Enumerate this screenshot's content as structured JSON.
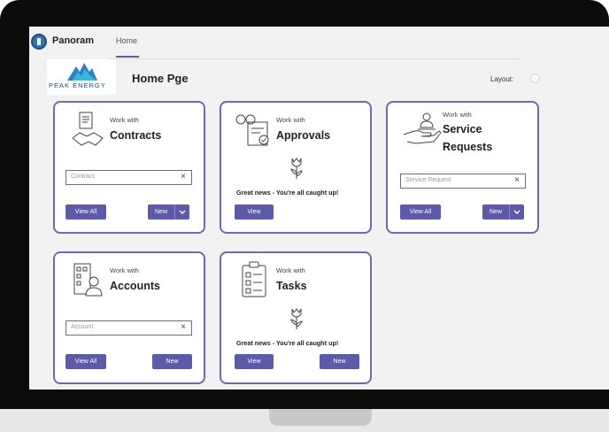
{
  "app": {
    "name": "Panoram",
    "nav_tab": "Home",
    "brand_text": "PEAK ENERGY"
  },
  "page": {
    "title": "Home Pge",
    "layout_label": "Layout:"
  },
  "cards": {
    "contracts": {
      "subtitle": "Work with",
      "title": "Contracts",
      "search_placeholder": "Contract",
      "view_all_label": "View All",
      "new_label": "New"
    },
    "approvals": {
      "subtitle": "Work with",
      "title": "Approvals",
      "message": "Great news - You're all caught up!",
      "view_label": "View"
    },
    "service_requests": {
      "subtitle": "Work with",
      "title_line1": "Service",
      "title_line2": "Requests",
      "search_placeholder": "Service Request",
      "view_all_label": "View All",
      "new_label": "New"
    },
    "accounts": {
      "subtitle": "Work with",
      "title": "Accounts",
      "search_placeholder": "Account",
      "view_all_label": "View All",
      "new_label": "New"
    },
    "tasks": {
      "subtitle": "Work with",
      "title": "Tasks",
      "message": "Great news - You're all caught up!",
      "view_label": "View",
      "new_label": "New"
    }
  },
  "colors": {
    "accent": "#5d5aa7",
    "card_border": "#6f6aaf",
    "brand_blue": "#1a4c8b"
  },
  "icons": [
    "app-logo-icon",
    "peak-energy-logo",
    "contract-handshake-icon",
    "approvals-glasses-icon",
    "service-hand-icon",
    "accounts-org-icon",
    "tasks-checklist-icon",
    "tulip-icon",
    "close-icon",
    "chevron-down-icon"
  ]
}
